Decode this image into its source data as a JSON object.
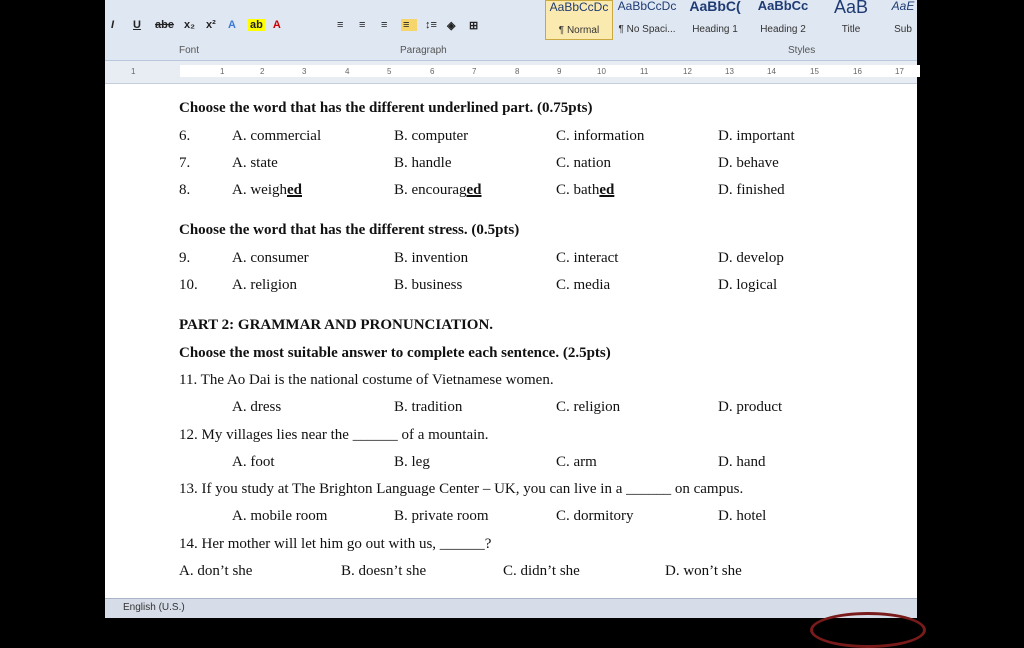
{
  "ribbon": {
    "font_group": "Font",
    "paragraph_group": "Paragraph",
    "styles_group": "Styles",
    "style_tiles": [
      {
        "sample": "AaBbCcDc",
        "name": "¶ Normal"
      },
      {
        "sample": "AaBbCcDc",
        "name": "¶ No Spaci..."
      },
      {
        "sample": "AaBbC(",
        "name": "Heading 1"
      },
      {
        "sample": "AaBbCc",
        "name": "Heading 2"
      },
      {
        "sample": "AaB",
        "name": "Title"
      },
      {
        "sample": "AaE",
        "name": "Sub"
      }
    ]
  },
  "ruler": {
    "numbers": [
      "1",
      "1",
      "2",
      "3",
      "4",
      "5",
      "6",
      "7",
      "8",
      "9",
      "10",
      "11",
      "12",
      "13",
      "14",
      "15",
      "16",
      "17"
    ]
  },
  "doc": {
    "section1": "Choose the word that has the different underlined part. (0.75pts)",
    "q6": {
      "num": "6.",
      "a": "A. commercial",
      "b": "B. computer",
      "c": "C. information",
      "d": "D. important"
    },
    "q7": {
      "num": "7.",
      "a": "A. state",
      "b": "B. handle",
      "c": "C. nation",
      "d": "D. behave"
    },
    "q8": {
      "num": "8.",
      "a_pre": "A. weigh",
      "a_u": "ed",
      "b_pre": "B. encourag",
      "b_u": "ed",
      "c_pre": "C. bath",
      "c_u": "ed",
      "d_pre": "D. finished",
      "d_u": ""
    },
    "section2": "Choose the word that has the different stress. (0.5pts)",
    "q9": {
      "num": "9.",
      "a": "A. consumer",
      "b": "B. invention",
      "c": "C. interact",
      "d": "D. develop"
    },
    "q10": {
      "num": "10.",
      "a": "A. religion",
      "b": "B. business",
      "c": "C. media",
      "d": "D. logical"
    },
    "part2": "PART 2: GRAMMAR AND PRONUNCIATION.",
    "section3": "Choose the most suitable answer to complete each sentence. (2.5pts)",
    "q11": {
      "stem": "11. The Ao Dai is the national costume of Vietnamese women.",
      "a": "A. dress",
      "b": "B. tradition",
      "c": "C. religion",
      "d": "D. product"
    },
    "q12": {
      "stem": "12. My villages  lies near the ______ of a mountain.",
      "a": "A. foot",
      "b": "B. leg",
      "c": "C. arm",
      "d": "D. hand"
    },
    "q13": {
      "stem": "13. If you study at The Brighton Language Center – UK, you can live in a ______ on campus.",
      "a": "A. mobile room",
      "b": "B. private room",
      "c": "C. dormitory",
      "d": "D. hotel"
    },
    "q14": {
      "stem": "14. Her mother will let him go out with us, ______?",
      "a": "A. don’t she",
      "b": "B. doesn’t she",
      "c": "C. didn’t she",
      "d": "D. won’t she"
    }
  },
  "status": {
    "language": "English (U.S.)"
  }
}
